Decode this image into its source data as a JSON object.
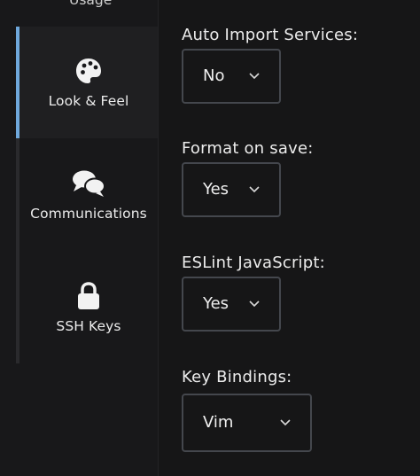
{
  "sidebar": {
    "cut_off_item_label": "Usage",
    "items": [
      {
        "label": "Look & Feel",
        "icon": "palette-icon",
        "active": true
      },
      {
        "label": "Communications",
        "icon": "chat-bubbles-icon",
        "active": false
      },
      {
        "label": "SSH Keys",
        "icon": "lock-icon",
        "active": false
      }
    ]
  },
  "settings": {
    "auto_import": {
      "label": "Auto Import Services:",
      "value": "No"
    },
    "format_on_save": {
      "label": "Format on save:",
      "value": "Yes"
    },
    "eslint": {
      "label": "ESLint JavaScript:",
      "value": "Yes"
    },
    "key_bindings": {
      "label": "Key Bindings:",
      "value": "Vim"
    }
  },
  "colors": {
    "accent": "#6fa8dc",
    "background": "#161617",
    "sidebar_bg": "#18181a",
    "border": "#44474d"
  }
}
